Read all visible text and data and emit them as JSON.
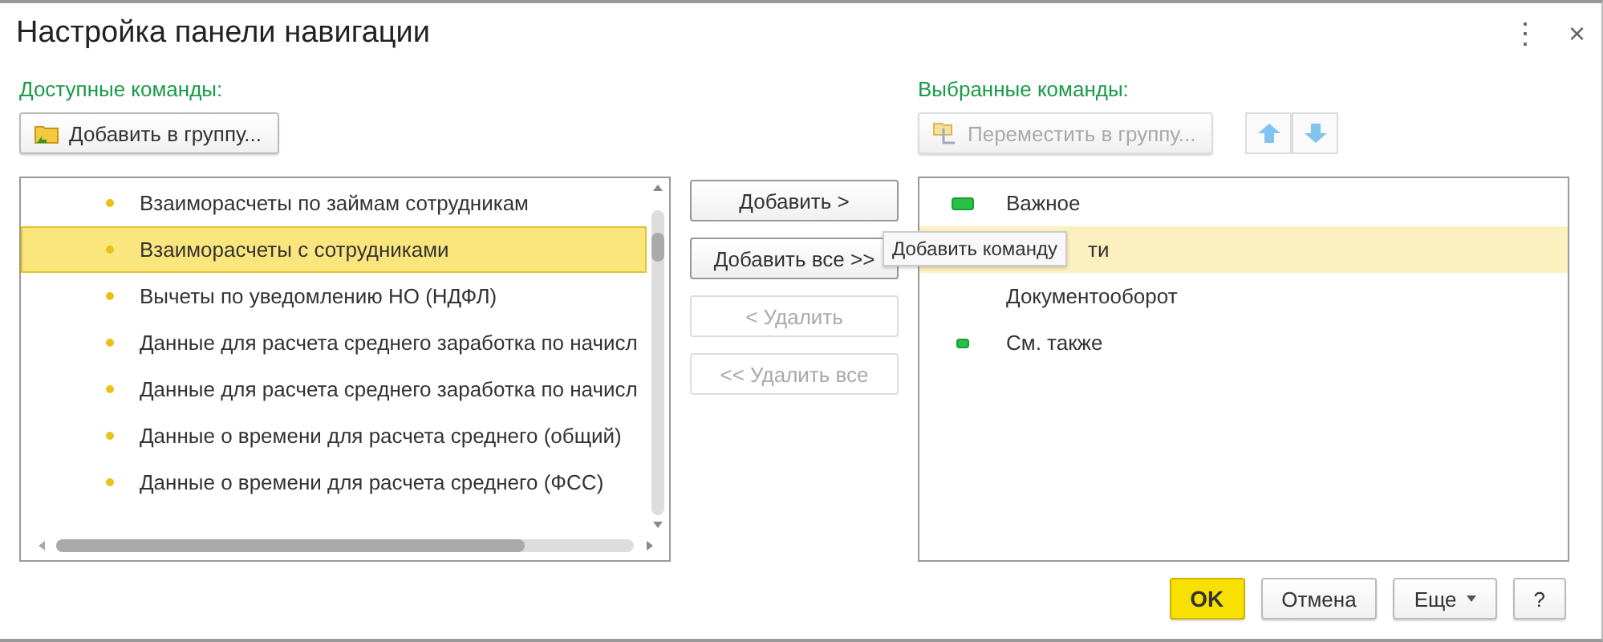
{
  "window": {
    "title": "Настройка панели навигации",
    "menu_glyph": "⋮",
    "close_glyph": "×"
  },
  "available": {
    "label": "Доступные команды:",
    "add_to_group": "Добавить в группу...",
    "items": [
      {
        "text": "Взаиморасчеты по займам сотрудникам",
        "selected": false
      },
      {
        "text": "Взаиморасчеты с сотрудниками",
        "selected": true
      },
      {
        "text": "Вычеты по уведомлению НО (НДФЛ)",
        "selected": false
      },
      {
        "text": "Данные для расчета среднего заработка по начисл",
        "selected": false
      },
      {
        "text": "Данные для расчета среднего заработка по начисл",
        "selected": false
      },
      {
        "text": "Данные о времени для расчета среднего (общий)",
        "selected": false
      },
      {
        "text": "Данные о времени для расчета среднего (ФСС)",
        "selected": false
      }
    ]
  },
  "transfer_buttons": [
    {
      "label": "Добавить >",
      "disabled": false
    },
    {
      "label": "Добавить все >>",
      "disabled": false
    },
    {
      "label": "< Удалить",
      "disabled": true
    },
    {
      "label": "<< Удалить все",
      "disabled": true
    }
  ],
  "tooltip": "Добавить команду",
  "selected_commands": {
    "label": "Выбранные команды:",
    "move_to_group": "Переместить в группу...",
    "move_disabled": true,
    "items": [
      {
        "text": "Важное",
        "kind": "important",
        "selected": false
      },
      {
        "text": "ти",
        "kind": "plain",
        "selected": true
      },
      {
        "text": "Документооборот",
        "kind": "plain",
        "selected": false
      },
      {
        "text": "См. также",
        "kind": "see-also",
        "selected": false
      }
    ]
  },
  "footer": {
    "ok": "OK",
    "cancel": "Отмена",
    "more": "Еще",
    "help": "?"
  }
}
